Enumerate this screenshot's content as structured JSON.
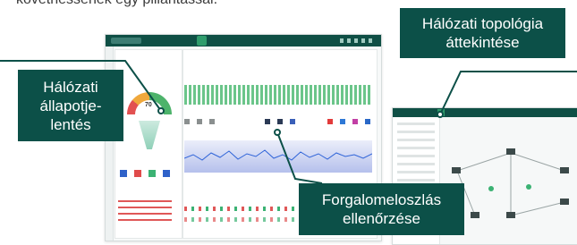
{
  "intro_text": "követhessenek egy pillantással.",
  "callouts": {
    "status": [
      "Hálózati",
      "állapotje-",
      "lentés"
    ],
    "topology": [
      "Hálózati topológia",
      "áttekintése"
    ],
    "traffic": [
      "Forgalomeloszlás",
      "ellenőrzése"
    ]
  },
  "dashboard": {
    "gauge_value": "70"
  },
  "colors": {
    "brand_dark": "#0c5048",
    "accent_green": "#2f9c6c"
  }
}
